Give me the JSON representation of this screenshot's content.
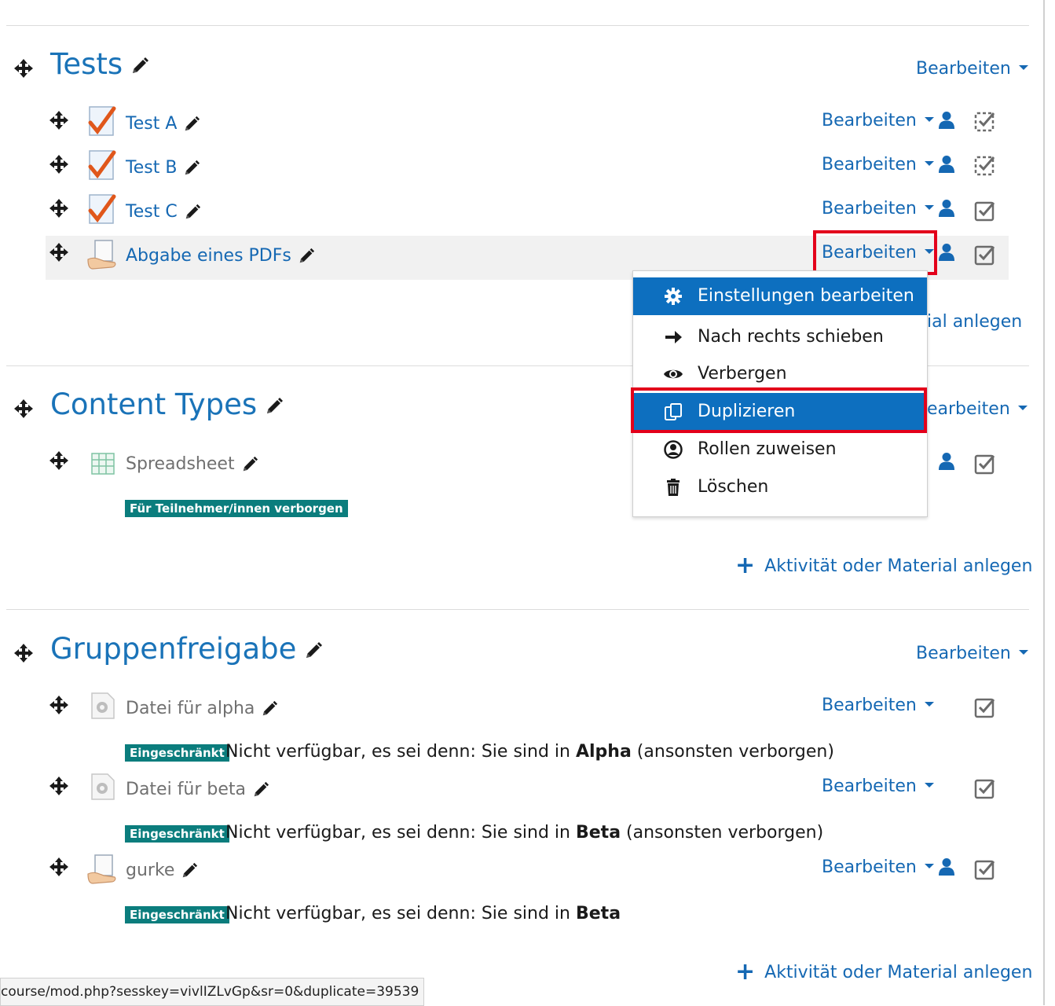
{
  "sections": [
    {
      "title": "Tests",
      "edit_label": "Bearbeiten",
      "activities": [
        {
          "name": "Test A",
          "icon": "quiz-icon",
          "edit_label": "Bearbeiten",
          "completion": "manual-pending"
        },
        {
          "name": "Test B",
          "icon": "quiz-icon",
          "edit_label": "Bearbeiten",
          "completion": "manual-pending"
        },
        {
          "name": "Test C",
          "icon": "quiz-icon",
          "edit_label": "Bearbeiten",
          "completion": "checked"
        },
        {
          "name": "Abgabe eines PDFs",
          "icon": "assignment-icon",
          "edit_label": "Bearbeiten",
          "completion": "checked"
        }
      ],
      "add_label_partial": "ial anlegen"
    },
    {
      "title": "Content Types",
      "edit_label_partial": "earbeiten",
      "activities": [
        {
          "name": "Spreadsheet",
          "icon": "spreadsheet-icon",
          "badge": "Für Teilnehmer/innen verborgen"
        }
      ],
      "add_label": "Aktivität oder Material anlegen"
    },
    {
      "title": "Gruppenfreigabe",
      "edit_label": "Bearbeiten",
      "activities": [
        {
          "name": "Datei für alpha",
          "icon": "file-icon",
          "edit_label": "Bearbeiten",
          "badge": "Eingeschränkt",
          "restriction": {
            "prefix": "Nicht verfügbar, es sei denn: Sie sind in ",
            "group": "Alpha",
            "suffix": " (ansonsten verborgen)"
          }
        },
        {
          "name": "Datei für beta",
          "icon": "file-icon",
          "edit_label": "Bearbeiten",
          "badge": "Eingeschränkt",
          "restriction": {
            "prefix": "Nicht verfügbar, es sei denn: Sie sind in ",
            "group": "Beta",
            "suffix": " (ansonsten verborgen)"
          }
        },
        {
          "name": "gurke",
          "icon": "assignment-icon",
          "edit_label": "Bearbeiten",
          "badge": "Eingeschränkt",
          "restriction": {
            "prefix": "Nicht verfügbar, es sei denn: Sie sind in ",
            "group": "Beta",
            "suffix": ""
          }
        }
      ],
      "add_label": "Aktivität oder Material anlegen"
    }
  ],
  "dropdown_menu": {
    "items": [
      {
        "label": "Einstellungen bearbeiten",
        "icon": "gear-icon",
        "state": "hover"
      },
      {
        "label": "Nach rechts schieben",
        "icon": "arrow-right-icon"
      },
      {
        "label": "Verbergen",
        "icon": "eye-icon"
      },
      {
        "label": "Duplizieren",
        "icon": "duplicate-icon",
        "state": "highlighted"
      },
      {
        "label": "Rollen zuweisen",
        "icon": "user-circle-icon"
      },
      {
        "label": "Löschen",
        "icon": "trash-icon"
      }
    ]
  },
  "status_bar": {
    "url": "course/mod.php?sesskey=vivlIZLvGp&sr=0&duplicate=39539"
  },
  "colors": {
    "link": "#1568b3",
    "title": "#1a73b8",
    "menu_active": "#0d6fbf",
    "badge": "#0b7d7d",
    "annotation": "#e3001b"
  }
}
